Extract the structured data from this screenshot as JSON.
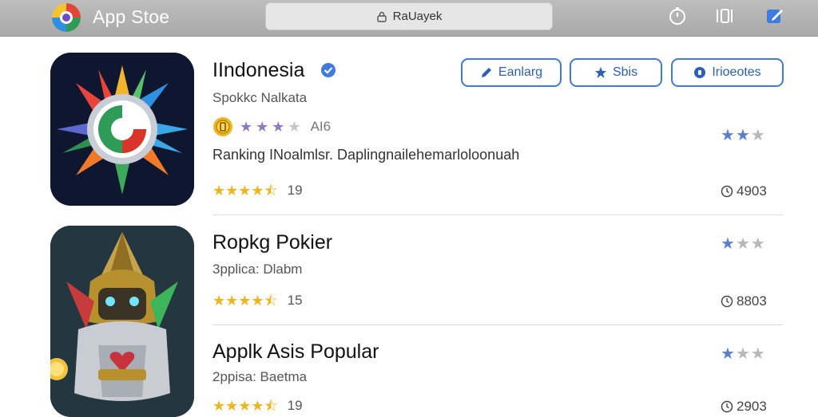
{
  "header": {
    "app_title": "App Stoe",
    "address": "RaUayek"
  },
  "actions": [
    {
      "label": "Eanlarg",
      "icon": "pencil-icon"
    },
    {
      "label": "Sbis",
      "icon": "star-badge-icon"
    },
    {
      "label": "Irioeotes",
      "icon": "info-icon"
    }
  ],
  "apps": [
    {
      "name": "IIndonesia",
      "verified": true,
      "subtitle": "Spokkc Nalkata",
      "mini_rating_label": "AI6",
      "mini_rating_stars": 3,
      "description": "Ranking INoalmlsr. Daplingnailehemarloloonuah",
      "rating_stars": 4.5,
      "rating_count": "19",
      "right_stars_filled": 2,
      "time": "4903"
    },
    {
      "name": "Ropkg Pokier",
      "verified": false,
      "subtitle": "3pplica: Dlabm",
      "rating_stars": 4.5,
      "rating_count": "15",
      "right_stars_filled": 1,
      "time": "8803"
    },
    {
      "name": "Applk Asis Popular",
      "verified": false,
      "subtitle": "2ppisa: Baetma",
      "rating_stars": 4.5,
      "rating_count": "19",
      "right_stars_filled": 1,
      "time": "2903"
    }
  ],
  "colors": {
    "accent": "#3d7be0",
    "star_gold": "#f1b51c",
    "topbar": "#b3b3b3"
  }
}
